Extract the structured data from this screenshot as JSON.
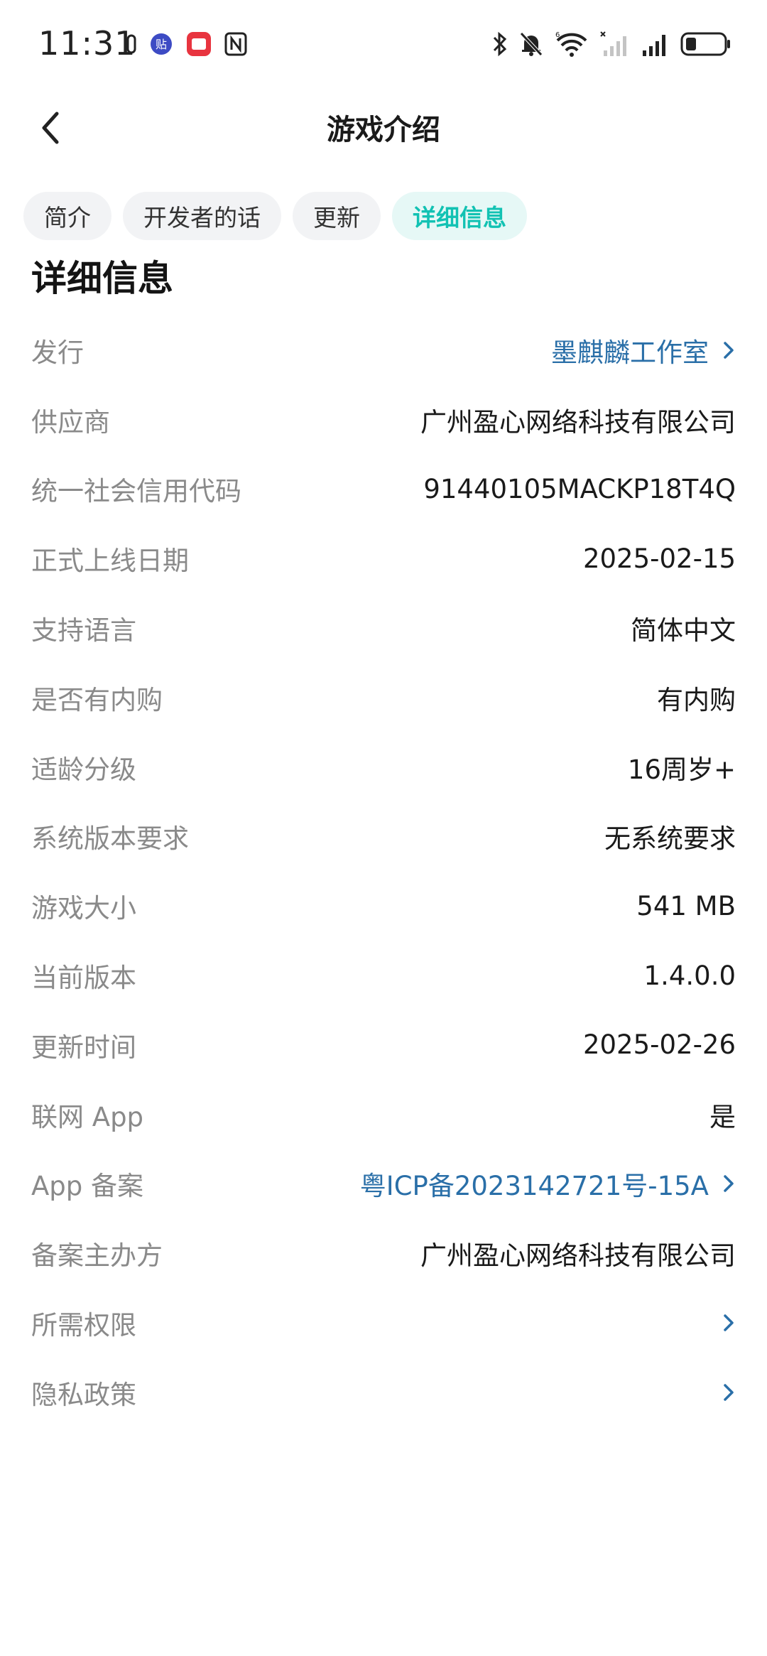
{
  "status_bar": {
    "time": "11:31",
    "left_icons": [
      "ring-icon",
      "app-badge-icon",
      "red-app-icon",
      "nfc-icon"
    ],
    "right_icons": [
      "bluetooth-icon",
      "mute-bell-icon",
      "wifi-icon",
      "signal-empty-icon",
      "signal-full-icon",
      "battery-icon"
    ]
  },
  "header": {
    "title": "游戏介绍",
    "back_icon": "chevron-left-icon"
  },
  "tabs": [
    {
      "label": "简介",
      "active": false
    },
    {
      "label": "开发者的话",
      "active": false
    },
    {
      "label": "更新",
      "active": false
    },
    {
      "label": "详细信息",
      "active": true
    }
  ],
  "section_title": "详细信息",
  "rows": [
    {
      "label": "发行",
      "value": "墨麒麟工作室",
      "link": true
    },
    {
      "label": "供应商",
      "value": "广州盈心网络科技有限公司",
      "link": false
    },
    {
      "label": "统一社会信用代码",
      "value": "91440105MACKP18T4Q",
      "link": false
    },
    {
      "label": "正式上线日期",
      "value": "2025-02-15",
      "link": false
    },
    {
      "label": "支持语言",
      "value": "简体中文",
      "link": false
    },
    {
      "label": "是否有内购",
      "value": "有内购",
      "link": false
    },
    {
      "label": "适龄分级",
      "value": "16周岁+",
      "link": false
    },
    {
      "label": "系统版本要求",
      "value": "无系统要求",
      "link": false
    },
    {
      "label": "游戏大小",
      "value": "541 MB",
      "link": false
    },
    {
      "label": "当前版本",
      "value": "1.4.0.0",
      "link": false
    },
    {
      "label": "更新时间",
      "value": "2025-02-26",
      "link": false
    },
    {
      "label": "联网 App",
      "value": "是",
      "link": false
    },
    {
      "label": "App 备案",
      "value": "粤ICP备2023142721号-15A",
      "link": true
    },
    {
      "label": "备案主办方",
      "value": "广州盈心网络科技有限公司",
      "link": false
    },
    {
      "label": "所需权限",
      "value": "",
      "link": true
    },
    {
      "label": "隐私政策",
      "value": "",
      "link": true
    }
  ],
  "colors": {
    "accent": "#12c2b3",
    "link": "#2a6fa8",
    "label": "#8a8a8a",
    "tab_bg": "#f2f3f5",
    "tab_active_bg": "#e6f8f6"
  }
}
